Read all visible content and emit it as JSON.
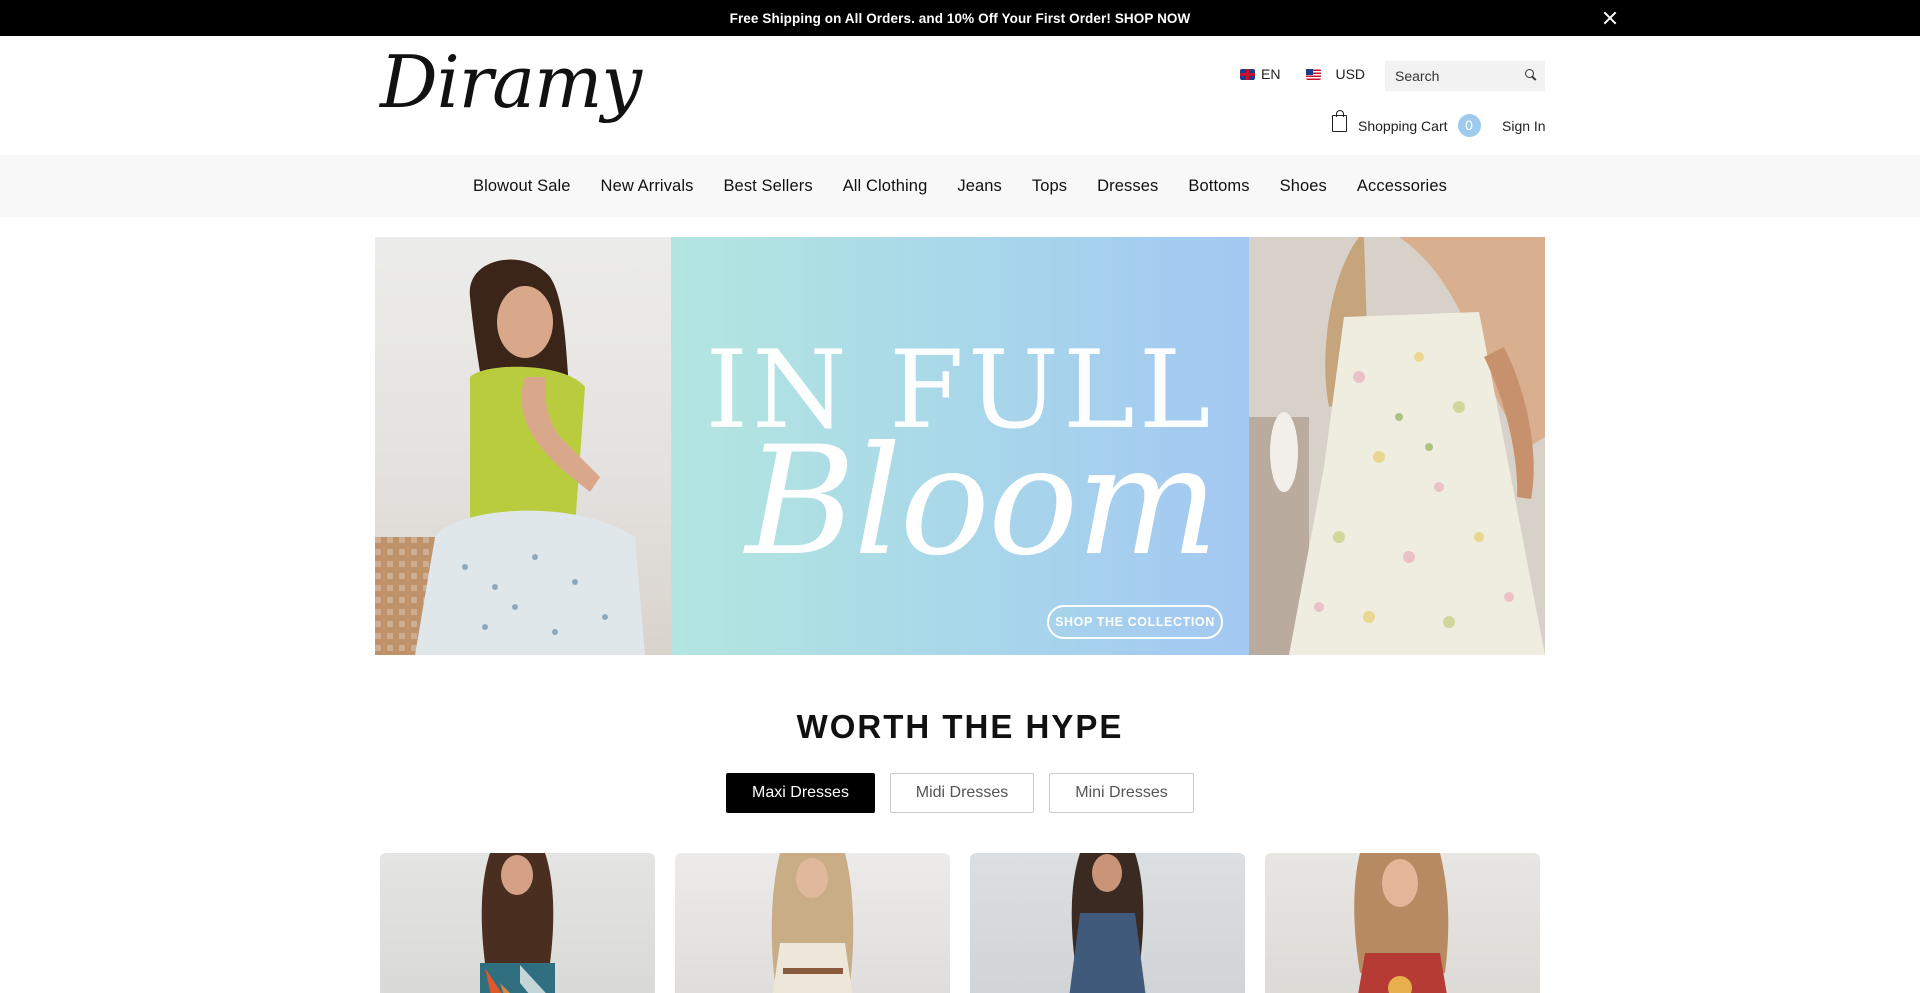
{
  "announcement": {
    "text": "Free Shipping on All Orders. and 10% Off Your First Order! SHOP NOW",
    "close_icon": "close-icon"
  },
  "header": {
    "logo": "Diramy",
    "language": "EN",
    "currency": "USD",
    "search_placeholder": "Search",
    "cart_label": "Shopping Cart",
    "cart_count": "0",
    "signin_label": "Sign In",
    "icons": [
      "uk-flag-icon",
      "us-flag-icon",
      "search-icon",
      "shopping-bag-icon"
    ]
  },
  "nav": {
    "items": [
      "Blowout Sale",
      "New Arrivals",
      "Best Sellers",
      "All Clothing",
      "Jeans",
      "Tops",
      "Dresses",
      "Bottoms",
      "Shoes",
      "Accessories"
    ]
  },
  "hero": {
    "title_line1": "IN FULL",
    "title_line2": "Bloom",
    "cta": "SHOP THE COLLECTION",
    "colors": {
      "gradient_start": "#b3e6e0",
      "gradient_end": "#a3c8f2"
    }
  },
  "section": {
    "title": "WORTH THE HYPE",
    "tabs": [
      {
        "label": "Maxi Dresses",
        "active": true
      },
      {
        "label": "Midi Dresses",
        "active": false
      },
      {
        "label": "Mini Dresses",
        "active": false
      }
    ]
  }
}
